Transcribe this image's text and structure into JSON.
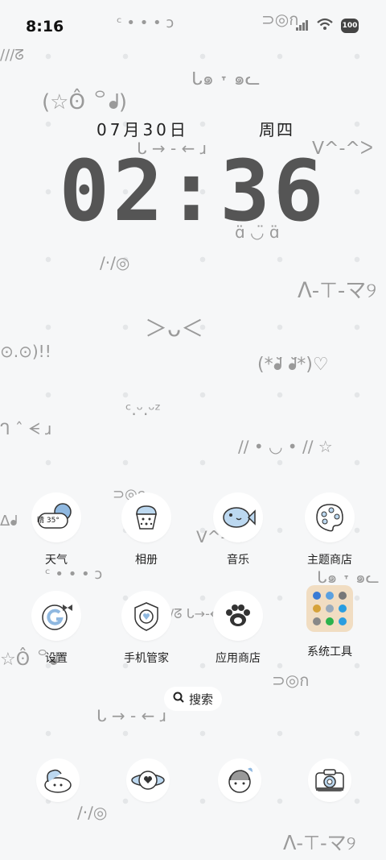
{
  "status_bar": {
    "time": "8:16",
    "battery": "100"
  },
  "lock": {
    "date": "07月30日",
    "weekday": "周四",
    "clock": "02:36"
  },
  "apps_row1": [
    {
      "label": "天气",
      "icon": "weather-icon",
      "weather_text": "晴 35°"
    },
    {
      "label": "相册",
      "icon": "gallery-icon"
    },
    {
      "label": "音乐",
      "icon": "music-icon"
    },
    {
      "label": "主题商店",
      "icon": "theme-store-icon"
    }
  ],
  "apps_row2": [
    {
      "label": "设置",
      "icon": "settings-icon"
    },
    {
      "label": "手机管家",
      "icon": "phone-manager-icon"
    },
    {
      "label": "应用商店",
      "icon": "app-store-icon"
    },
    {
      "label": "系统工具",
      "icon": "folder-icon"
    }
  ],
  "search": {
    "label": "搜索"
  },
  "dock": [
    {
      "icon": "phone-icon"
    },
    {
      "icon": "messages-icon"
    },
    {
      "icon": "browser-icon"
    },
    {
      "icon": "camera-icon"
    }
  ],
  "colors": {
    "background": "#f6f7f8",
    "accent_blue": "#bcd8f0",
    "folder": "#f1ddc2"
  }
}
